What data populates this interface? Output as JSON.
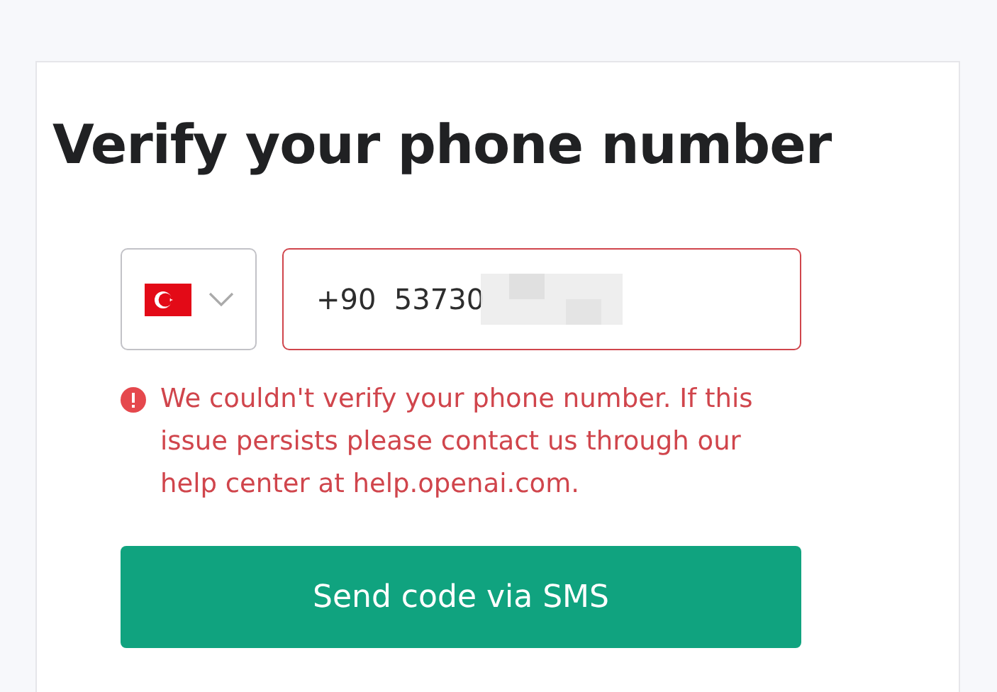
{
  "title": "Verify your phone number",
  "country_select": {
    "expanded": false
  },
  "phone_field": {
    "value": "+90  53730",
    "error": true
  },
  "error_message": "We couldn't verify your phone number. If this issue persists please contact us through our help center at help.openai.com.",
  "submit_button": "Send code via SMS"
}
